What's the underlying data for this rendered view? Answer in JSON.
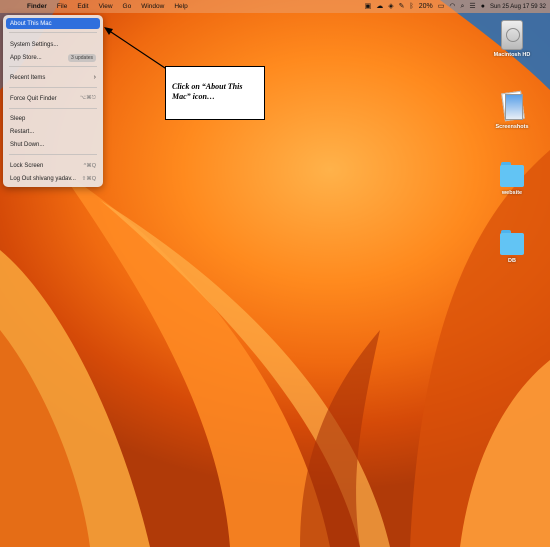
{
  "menubar": {
    "app_name": "Finder",
    "menus": [
      "File",
      "Edit",
      "View",
      "Go",
      "Window",
      "Help"
    ],
    "status": {
      "battery": "20%",
      "datetime": "Sun 25 Aug  17 59 32"
    }
  },
  "apple_menu": {
    "items": [
      {
        "label": "About This Mac",
        "selected": true
      },
      {
        "label": "System Settings..."
      },
      {
        "label": "App Store...",
        "badge": "3 updates"
      },
      {
        "label": "Recent Items",
        "shortcut": "›"
      },
      {
        "label": "Force Quit Finder",
        "shortcut": "⌥⌘⎋"
      },
      {
        "label": "Sleep"
      },
      {
        "label": "Restart..."
      },
      {
        "label": "Shut Down..."
      },
      {
        "label": "Lock Screen",
        "shortcut": "^⌘Q"
      },
      {
        "label": "Log Out shivang yadav...",
        "shortcut": "⇧⌘Q"
      }
    ]
  },
  "callout": {
    "text": "Click on “About This Mac” icon…"
  },
  "desktop_icons": [
    {
      "label": "Macintosh HD",
      "icon": "hard-drive-icon"
    },
    {
      "label": "Screenshots",
      "icon": "screenshots-icon"
    },
    {
      "label": "website",
      "icon": "folder-icon"
    },
    {
      "label": "DB",
      "icon": "folder-icon"
    }
  ],
  "colors": {
    "menu_highlight": "#2f6fdd",
    "folder": "#62c4f4"
  }
}
